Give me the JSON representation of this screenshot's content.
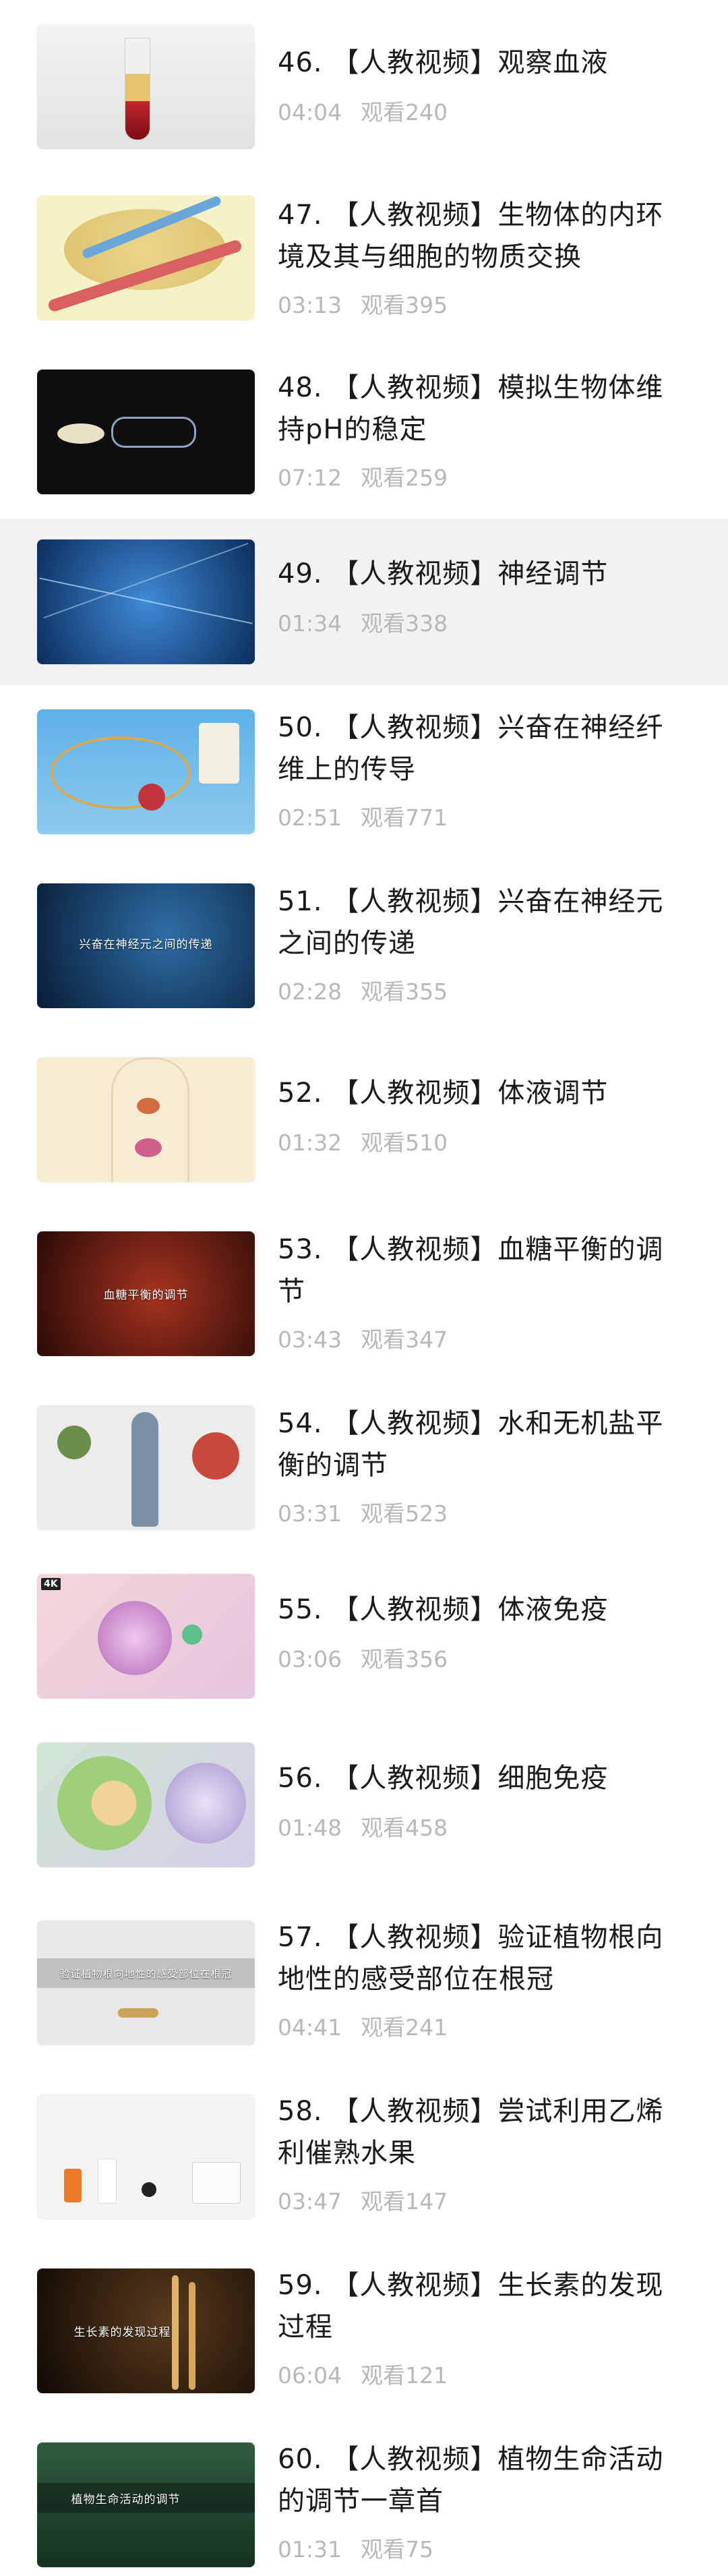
{
  "videos": [
    {
      "title": "46. 【人教视频】观察血液",
      "duration": "04:04",
      "views": "观看240",
      "thumb_caption": ""
    },
    {
      "title": "47. 【人教视频】生物体的内环境及其与细胞的物质交换",
      "duration": "03:13",
      "views": "观看395",
      "thumb_caption": ""
    },
    {
      "title": "48. 【人教视频】模拟生物体维持pH的稳定",
      "duration": "07:12",
      "views": "观看259",
      "thumb_caption": ""
    },
    {
      "title": "49. 【人教视频】神经调节",
      "duration": "01:34",
      "views": "观看338",
      "thumb_caption": ""
    },
    {
      "title": "50. 【人教视频】兴奋在神经纤维上的传导",
      "duration": "02:51",
      "views": "观看771",
      "thumb_caption": ""
    },
    {
      "title": "51. 【人教视频】兴奋在神经元之间的传递",
      "duration": "02:28",
      "views": "观看355",
      "thumb_caption": "兴奋在神经元之间的传递"
    },
    {
      "title": "52. 【人教视频】体液调节",
      "duration": "01:32",
      "views": "观看510",
      "thumb_caption": ""
    },
    {
      "title": "53. 【人教视频】血糖平衡的调节",
      "duration": "03:43",
      "views": "观看347",
      "thumb_caption": "血糖平衡的调节"
    },
    {
      "title": "54. 【人教视频】水和无机盐平衡的调节",
      "duration": "03:31",
      "views": "观看523",
      "thumb_caption": ""
    },
    {
      "title": "55. 【人教视频】体液免疫",
      "duration": "03:06",
      "views": "观看356",
      "thumb_caption": "",
      "thumb_tag": "4K"
    },
    {
      "title": "56. 【人教视频】细胞免疫",
      "duration": "01:48",
      "views": "观看458",
      "thumb_caption": ""
    },
    {
      "title": "57. 【人教视频】验证植物根向地性的感受部位在根冠",
      "duration": "04:41",
      "views": "观看241",
      "thumb_caption": "验证植物根向地性的感受部位在根冠"
    },
    {
      "title": "58. 【人教视频】尝试利用乙烯利催熟水果",
      "duration": "03:47",
      "views": "观看147",
      "thumb_caption": ""
    },
    {
      "title": "59. 【人教视频】生长素的发现过程",
      "duration": "06:04",
      "views": "观看121",
      "thumb_caption": "生长素的发现过程"
    },
    {
      "title": "60. 【人教视频】植物生命活动的调节一章首",
      "duration": "01:31",
      "views": "观看75",
      "thumb_caption": "植物生命活动的调节"
    }
  ],
  "colors": {
    "title": "#1a1a1a",
    "meta": "#b8b8b8",
    "highlight_row": "#f2f2f2"
  }
}
